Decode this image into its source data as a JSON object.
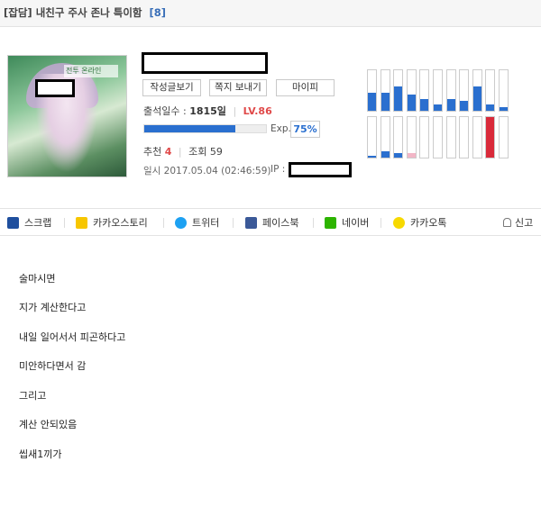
{
  "header": {
    "category": "[잡담]",
    "title": "내친구 주사 존나 특이함",
    "comment_count": "[8]"
  },
  "profile": {
    "avatar_logo": "전투 온라인",
    "buttons": {
      "posts": "작성글보기",
      "note": "쪽지 보내기",
      "mypi": "마이피"
    },
    "attendance_label": "출석일수 :",
    "attendance_days": "1815일",
    "level": "LV.86",
    "exp_label": "Exp.",
    "exp_percent": "75%",
    "exp_fraction": 0.75,
    "recommend_label": "추천",
    "recommend_count": "4",
    "views_label": "조회",
    "views_count": "59",
    "date": "일시 2017.05.04 (02:46:59)",
    "ip_label": "IP :"
  },
  "activity_bars": {
    "top_levels": [
      0.45,
      0.45,
      0.6,
      0.4,
      0.3,
      0.15,
      0.3,
      0.25,
      0.6,
      0.15,
      0.1
    ],
    "bottom_levels": [
      0.05,
      0.15,
      0.12,
      0.12,
      0,
      0,
      0,
      0,
      0,
      1.0,
      0
    ],
    "top_color": "#2a6fcf",
    "bottom_colors": [
      "#2a6fcf",
      "#2a6fcf",
      "#2a6fcf",
      "#f2b6c6",
      "#2a6fcf",
      "#2a6fcf",
      "#2a6fcf",
      "#2a6fcf",
      "#2a6fcf",
      "#d92a3a",
      "#2a6fcf"
    ]
  },
  "share": {
    "scrap": "스크랩",
    "kakaostory": "카카오스토리",
    "twitter": "트위터",
    "facebook": "페이스북",
    "naver": "네이버",
    "kakaotalk": "카카오톡",
    "report": "신고",
    "icons": [
      "scrap-icon",
      "kakaostory-icon",
      "twitter-icon",
      "facebook-icon",
      "naver-icon",
      "kakaotalk-icon",
      "bell-icon"
    ]
  },
  "content_lines": [
    "술마시면",
    "지가 계산한다고",
    "내일 일어서서 피곤하다고",
    "미안하다면서 감",
    "그리고",
    "계산 안되있음",
    "씹새1끼가"
  ]
}
